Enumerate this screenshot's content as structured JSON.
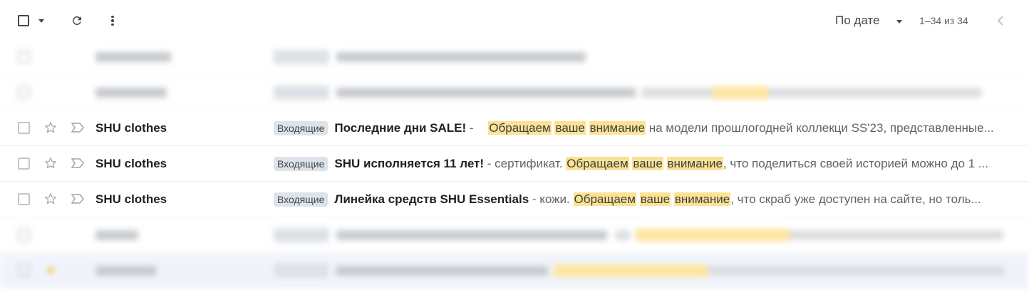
{
  "toolbar": {
    "sort_label": "По дате",
    "range_label": "1–34 из 34"
  },
  "rows": [
    {
      "sender": "SHU clothes",
      "label": "Входящие",
      "subject": "Последние дни SALE!",
      "separator": " - ",
      "highlights": [
        "Обращаем",
        "ваше",
        "внимание"
      ],
      "snippet_rest": " на модели прошлогодней коллекци SS'23, представленные..."
    },
    {
      "sender": "SHU clothes",
      "label": "Входящие",
      "subject": "SHU исполняется 11 лет!",
      "separator": " - сертификат. ",
      "highlights": [
        "Обращаем",
        "ваше",
        "внимание"
      ],
      "snippet_rest": ", что поделиться своей историей можно до 1 ..."
    },
    {
      "sender": "SHU clothes",
      "label": "Входящие",
      "subject": "Линейка средств SHU Essentials",
      "separator": " - кожи. ",
      "highlights": [
        "Обращаем",
        "ваше",
        "внимание"
      ],
      "snippet_rest": ", что скраб уже доступен на сайте, но толь..."
    }
  ],
  "colors": {
    "highlight": "#fde293",
    "label_chip": "#dde3ea",
    "row_border": "#eceff1",
    "selected_row_bg": "#eef2fb"
  }
}
